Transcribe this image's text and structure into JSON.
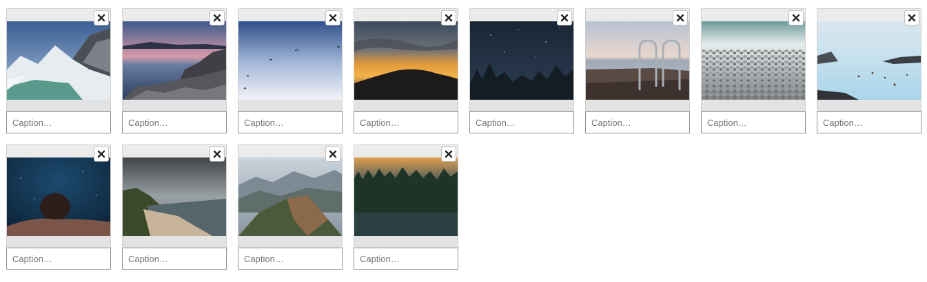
{
  "gallery": {
    "caption_placeholder": "Caption…",
    "items": [
      {
        "image": "snowy-mountain-lake"
      },
      {
        "image": "rocky-coast-sunset"
      },
      {
        "image": "birds-in-sky"
      },
      {
        "image": "orange-sunset-hill"
      },
      {
        "image": "starry-night-trees"
      },
      {
        "image": "dock-ladder-sea"
      },
      {
        "image": "pebble-beach"
      },
      {
        "image": "blue-lagoon-bathers"
      },
      {
        "image": "underwater-swimmer"
      },
      {
        "image": "stormy-beach-cliffs"
      },
      {
        "image": "mountain-ridge-valley"
      },
      {
        "image": "forest-at-dusk"
      }
    ]
  },
  "icons": {
    "remove": "close-icon"
  }
}
